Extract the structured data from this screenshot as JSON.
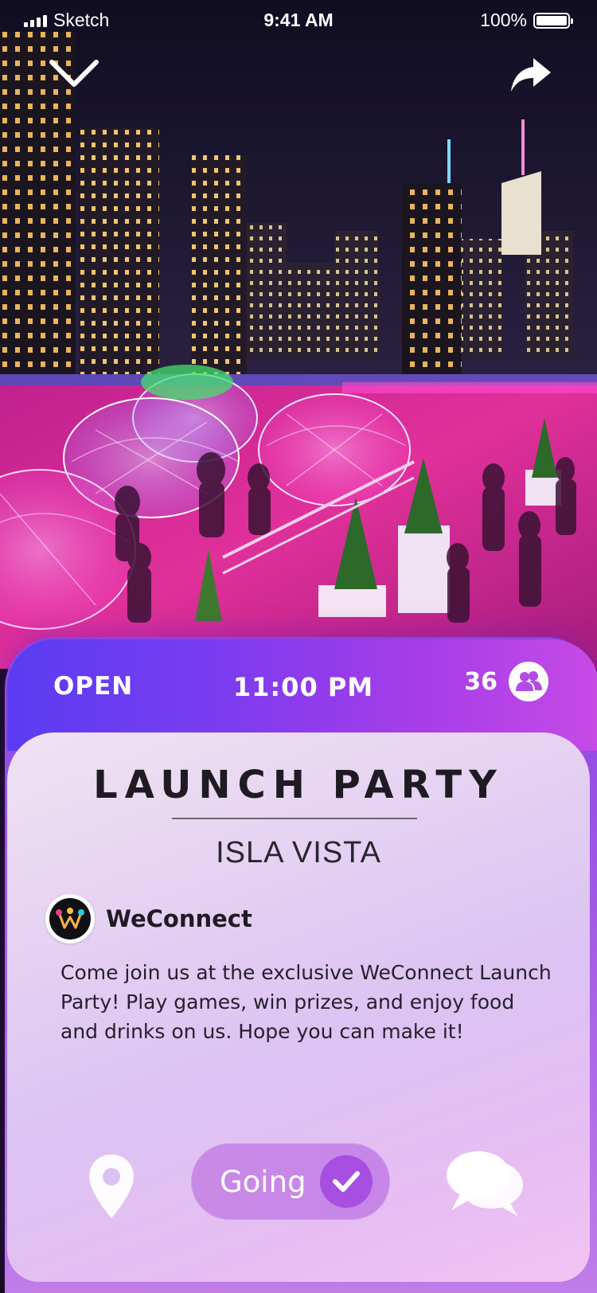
{
  "status_bar": {
    "carrier": "Sketch",
    "time": "9:41 AM",
    "battery": "100%",
    "battery_level": 1.0
  },
  "nav": {
    "collapse_icon": "chevron-down-icon",
    "share_icon": "share-arrow-icon"
  },
  "event": {
    "status": "OPEN",
    "time": "11:00 PM",
    "attendee_count": "36",
    "attendee_icon": "people-icon",
    "title": "LAUNCH PARTY",
    "location": "ISLA VISTA",
    "host": {
      "name": "WeConnect",
      "logo_icon": "weconnect-logo-icon"
    },
    "description": "Come join us at the exclusive WeConnect Launch Party! Play games, win prizes, and enjoy food and drinks on us.  Hope you can make it!"
  },
  "actions": {
    "location_icon": "map-pin-icon",
    "going_label": "Going",
    "going_checked": true,
    "chat_icon": "chat-bubbles-icon"
  },
  "colors": {
    "header_gradient_start": "#5a3cf2",
    "header_gradient_end": "#c64be6",
    "card_bg": "#e7d4f2",
    "going_pill": "#c98ae6",
    "going_check": "#a64fe0"
  }
}
